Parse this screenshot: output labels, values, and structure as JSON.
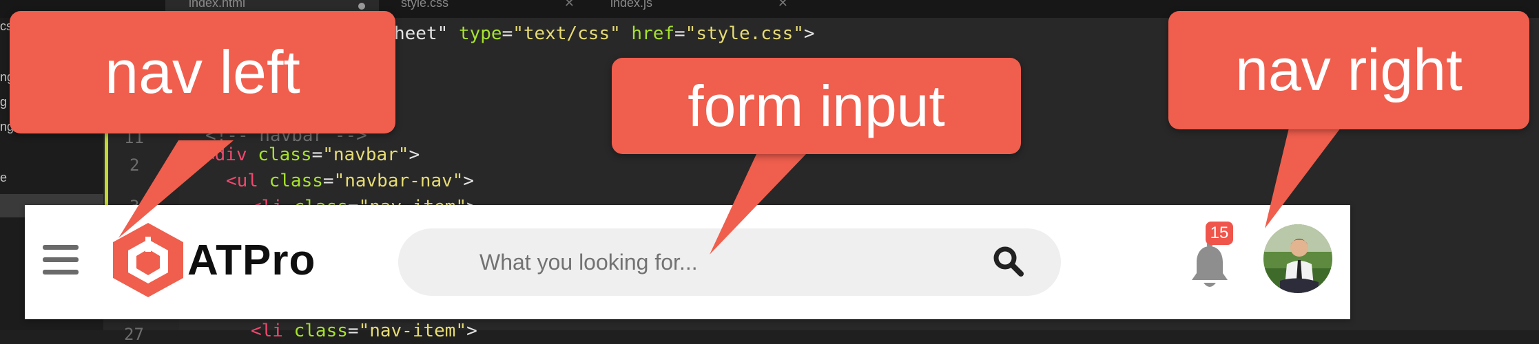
{
  "editor": {
    "tabs": [
      "index.html",
      "style.css",
      "index.js"
    ],
    "tree_items": [
      "cs",
      "ng",
      "g",
      "ng",
      "e"
    ],
    "line_numbers": [
      "11",
      "2",
      "3",
      "27"
    ],
    "code": {
      "line1": [
        "heet\"",
        " ",
        "type",
        "=",
        "\"text/css\"",
        " ",
        "href",
        "=",
        "\"style.css\"",
        ">"
      ],
      "line_comment": "<!-- navbar -->",
      "line_div": [
        "<div",
        " ",
        "class",
        "=",
        "\"navbar\"",
        ">"
      ],
      "line_ul": [
        "<ul",
        " ",
        "class",
        "=",
        "\"navbar-nav\"",
        ">"
      ],
      "line_li_top": [
        "<li",
        " ",
        "class",
        "=",
        "\"nav-item\"",
        ">"
      ],
      "line_li_bottom": [
        "<li",
        " ",
        "class",
        "=",
        "\"nav-item\"",
        ">"
      ]
    }
  },
  "navbar": {
    "menu_icon": "hamburger-icon",
    "logo_icon": "atpro-hexagon-logo",
    "brand": "ATPro",
    "search": {
      "placeholder": "What you looking for...",
      "value": "",
      "icon": "search-icon"
    },
    "notifications": {
      "icon": "bell-icon",
      "count": "15"
    },
    "avatar_icon": "user-avatar"
  },
  "callouts": {
    "nav_left": "nav left",
    "form_input": "form input",
    "nav_right": "nav right"
  },
  "colors": {
    "accent": "#f05e4d",
    "badge": "#f0554b",
    "editor_bg": "#282828",
    "navbar_bg": "#ffffff",
    "search_bg": "#efefef"
  }
}
